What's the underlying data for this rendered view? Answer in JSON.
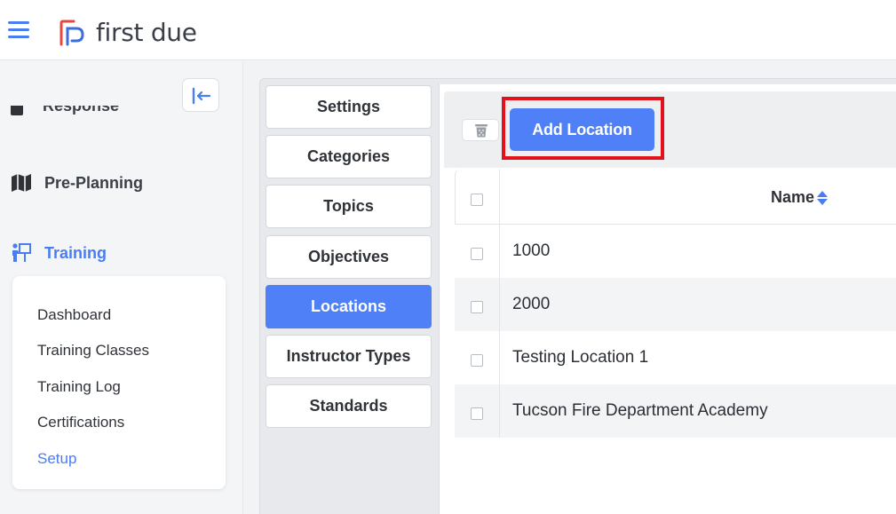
{
  "app": {
    "brand": "first due"
  },
  "sidebar": {
    "partial_item_label": "Response",
    "items": [
      {
        "label": "Pre-Planning",
        "icon": "map-icon"
      },
      {
        "label": "Training",
        "icon": "training-icon",
        "active": true
      }
    ],
    "subitems": [
      {
        "label": "Dashboard"
      },
      {
        "label": "Training Classes"
      },
      {
        "label": "Training Log"
      },
      {
        "label": "Certifications"
      },
      {
        "label": "Setup",
        "active": true
      }
    ]
  },
  "tabs": [
    {
      "label": "Settings"
    },
    {
      "label": "Categories"
    },
    {
      "label": "Topics"
    },
    {
      "label": "Objectives"
    },
    {
      "label": "Locations",
      "active": true
    },
    {
      "label": "Instructor Types"
    },
    {
      "label": "Standards"
    }
  ],
  "toolbar": {
    "add_label": "Add Location"
  },
  "table": {
    "column_name": "Name",
    "rows": [
      {
        "name": "1000"
      },
      {
        "name": "2000"
      },
      {
        "name": "Testing Location 1"
      },
      {
        "name": "Tucson Fire Department Academy"
      }
    ]
  },
  "colors": {
    "accent": "#4f80f7",
    "highlight": "#e3111b"
  }
}
